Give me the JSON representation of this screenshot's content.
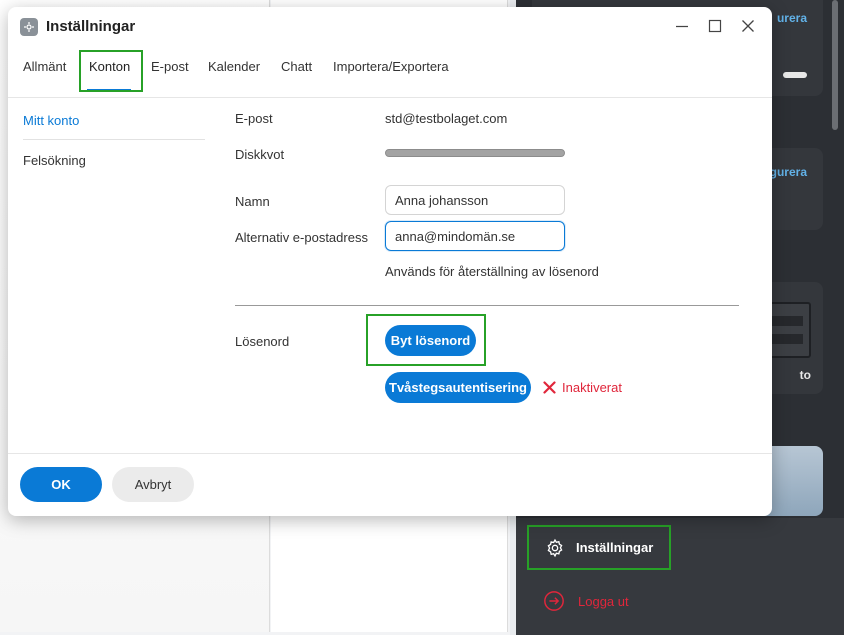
{
  "dialog": {
    "title": "Inställningar",
    "tabs": [
      "Allmänt",
      "Konton",
      "E-post",
      "Kalender",
      "Chatt",
      "Importera/Exportera"
    ],
    "active_tab": "Konton",
    "sidebar": [
      "Mitt konto",
      "Felsökning"
    ],
    "form": {
      "email_label": "E-post",
      "email_value": "std@testbolaget.com",
      "quota_label": "Diskkvot",
      "name_label": "Namn",
      "name_value": "Anna johansson",
      "alt_email_label": "Alternativ e-postadress",
      "alt_email_value": "anna@mindomän.se",
      "alt_email_hint": "Används för återställning av lösenord",
      "password_label": "Lösenord",
      "change_password_button": "Byt lösenord",
      "two_factor_button": "Tvåstegsautentisering",
      "two_factor_status": "Inaktiverat"
    },
    "footer": {
      "ok_label": "OK",
      "cancel_label": "Avbryt"
    }
  },
  "background": {
    "card1_link": "urera",
    "card2_link": "gurera",
    "card3_text": "to",
    "menu_settings": "Inställningar",
    "menu_logout": "Logga ut"
  },
  "colors": {
    "accent": "#0a7ad6",
    "highlight_box": "#27a127",
    "danger": "#e0263b",
    "dark_panel": "#2c2f34"
  },
  "icons": [
    "app-settings-icon",
    "minimize-icon",
    "maximize-icon",
    "close-icon",
    "x-icon",
    "gear-icon",
    "logout-icon"
  ]
}
